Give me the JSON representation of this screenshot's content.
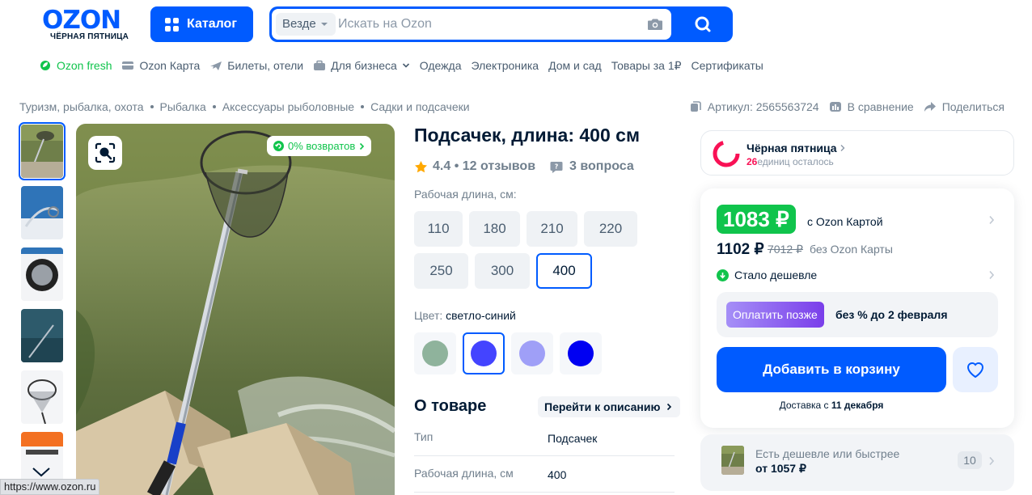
{
  "header": {
    "logo": "OZON",
    "logo_sub": "ЧЁРНАЯ ПЯТНИЦА",
    "catalog_label": "Каталог",
    "search_scope": "Везде",
    "search_placeholder": "Искать на Ozon"
  },
  "nav": [
    "Ozon fresh",
    "Ozon Карта",
    "Билеты, отели",
    "Для бизнеса",
    "Одежда",
    "Электроника",
    "Дом и сад",
    "Товары за 1₽",
    "Сертификаты"
  ],
  "breadcrumbs": [
    "Туризм, рыбалка, охота",
    "Рыбалка",
    "Аксессуары рыболовные",
    "Садки и подсачеки"
  ],
  "meta": {
    "article": "Артикул: 2565563724",
    "compare": "В сравнение",
    "share": "Поделиться"
  },
  "badge_return": "0% возвратов",
  "product": {
    "title": "Подсачек, длина: 400 см",
    "rating": "4.4 • 12 отзывов",
    "questions": "3 вопроса",
    "length_label": "Рабочая длина, см:",
    "sizes": [
      "110",
      "180",
      "210",
      "220",
      "250",
      "300",
      "400"
    ],
    "selected_size": "400",
    "color_label": "Цвет:",
    "color_value": "светло-синий",
    "swatches": [
      "#8fb39c",
      "#4444ff",
      "#9f9ff7",
      "#0000f2"
    ],
    "selected_swatch": 1
  },
  "about": {
    "title": "О товаре",
    "goto": "Перейти к описанию",
    "specs": [
      {
        "key": "Тип",
        "value": "Подсачек"
      },
      {
        "key": "Рабочая длина, см",
        "value": "400"
      }
    ]
  },
  "black_friday": {
    "title": "Чёрная пятница",
    "count": "26",
    "rest": "единиц осталось"
  },
  "price": {
    "card_price": "1083 ₽",
    "card_label": "с Ozon Картой",
    "price": "1102 ₽",
    "old_price": "7012 ₽",
    "price_label": "без Ozon Карты",
    "cheaper_label": "Стало дешевле",
    "paylater_pill": "Оплатить позже",
    "paylater_text": "без % до 2 февраля",
    "cart_button": "Добавить в корзину",
    "delivery_prefix": "Доставка с",
    "delivery_date": "11 декабря"
  },
  "cheaper_card": {
    "line1": "Есть дешевле или быстрее",
    "line2": "от 1057 ₽",
    "count": "10"
  },
  "status_url": "https://www.ozon.ru",
  "colors": {
    "brand": "#005bff",
    "green": "#10c44c",
    "pink": "#f91155"
  }
}
